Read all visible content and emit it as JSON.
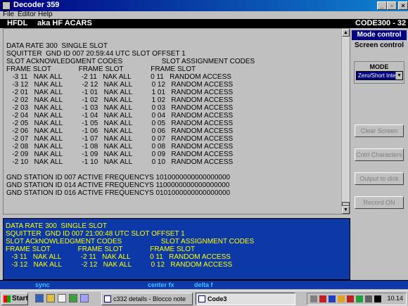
{
  "window": {
    "title": "Decoder 359"
  },
  "menu": {
    "items": [
      "File",
      "Editor",
      "Help"
    ]
  },
  "mode_bar": {
    "left": "HFDL",
    "middle": "aka HF ACARS",
    "right": "CODE300 - 32"
  },
  "upper_panel": {
    "lines": [
      "DATA RATE 300  SINGLE SLOT",
      "SQUITTER  GND ID 007 20:59:44 UTC SLOT OFFSET 1",
      "SLOT ACkNOWLEDGMENT CODES                    SLOT ASSIGNMENT CODES",
      "FRAME SLOT              FRAME SLOT              FRAME SLOT",
      "   -3 11   NAK ALL          -2 11   NAK ALL          0 11   RANDOM ACCESS",
      "   -3 12   NAK ALL          -2 12   NAK ALL          0 12   RANDOM ACCESS",
      "   -2 01   NAK ALL          -1 01   NAK ALL          1 01   RANDOM ACCESS",
      "   -2 02   NAK ALL          -1 02   NAK ALL          1 02   RANDOM ACCESS",
      "   -2 03   NAK ALL          -1 03   NAK ALL          0 03   RANDOM ACCESS",
      "   -2 04   NAK ALL          -1 04   NAK ALL          0 04   RANDOM ACCESS",
      "   -2 05   NAK ALL          -1 05   NAK ALL          0 05   RANDOM ACCESS",
      "   -2 06   NAK ALL          -1 06   NAK ALL          0 06   RANDOM ACCESS",
      "   -2 07   NAK ALL          -1 07   NAK ALL          0 07   RANDOM ACCESS",
      "   -2 08   NAK ALL          -1 08   NAK ALL          0 08   RANDOM ACCESS",
      "   -2 09   NAK ALL          -1 09   NAK ALL          0 09   RANDOM ACCESS",
      "   -2 10   NAK ALL          -1 10   NAK ALL          0 10   RANDOM ACCESS",
      "",
      "GND STATION ID 007 ACTIVE FREQUENCYS 1010000000000000000",
      "GND STATION ID 014 ACTIVE FREQUENCYS 1100000000000000000",
      "GND STATION ID 016 ACTIVE FREQUENCYS 0101000000000000000"
    ]
  },
  "lower_panel": {
    "lines": [
      "DATA RATE 300  SINGLE SLOT",
      "SQUITTER  GND ID 007 21:00:48 UTC SLOT OFFSET 1",
      "SLOT ACkNOWLEDGMENT CODES                    SLOT ASSIGNMENT CODES",
      "FRAME SLOT              FRAME SLOT              FRAME SLOT",
      "   -3 11   NAK ALL          -2 11   NAK ALL          0 11   RANDOM ACCESS",
      "   -3 12   NAK ALL          -2 12   NAK ALL          0 12   RANDOM ACCESS"
    ],
    "text_color": "#ffff00",
    "background": "#0c38a8"
  },
  "right_panel": {
    "mode_control": "Mode control",
    "screen_control": "Screen control",
    "mode_label": "MODE",
    "mode_value": "Zero/Short Inte",
    "buttons": {
      "clear_screen": "Clear Screen",
      "cntrl_characters": "Cntrl Characters",
      "output_to_disk": "Output to disk",
      "record_on": "Record ON"
    }
  },
  "status_bar": {
    "sync": "sync",
    "center_fx": "center fx",
    "delta_f": "delta f"
  },
  "taskbar": {
    "start": "Start",
    "tasks": [
      "c332 details - Blocco note",
      "Code3"
    ],
    "clock": "10.14"
  }
}
